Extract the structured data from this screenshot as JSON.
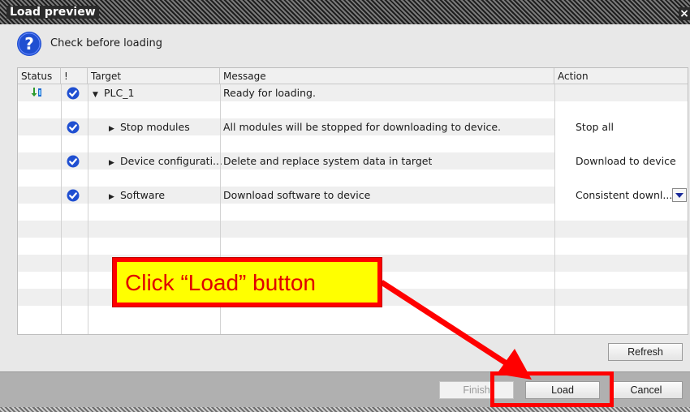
{
  "window": {
    "title": "Load preview",
    "close_glyph": "×"
  },
  "info": {
    "icon": "question-circle-icon",
    "text": "Check before loading"
  },
  "table": {
    "headers": {
      "status": "Status",
      "bang": "!",
      "target": "Target",
      "message": "Message",
      "action": "Action"
    },
    "rows": [
      {
        "target": "PLC_1",
        "message": "Ready for loading.",
        "action": ""
      },
      {
        "target": "Stop modules",
        "message": "All modules will be stopped for downloading to device.",
        "action": "Stop all"
      },
      {
        "target": "Device configurati...",
        "message": "Delete and replace system data in target",
        "action": "Download to device"
      },
      {
        "target": "Software",
        "message": "Download software to device",
        "action": "Consistent downl..."
      }
    ]
  },
  "buttons": {
    "refresh": "Refresh",
    "finish": "Finish",
    "load": "Load",
    "cancel": "Cancel"
  },
  "annotation": {
    "text": "Click “Load” button"
  },
  "colors": {
    "accent_blue": "#1f4fd1",
    "annotation_red": "#ff0000",
    "annotation_yellow": "#ffff00"
  }
}
